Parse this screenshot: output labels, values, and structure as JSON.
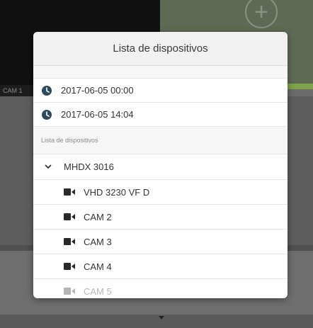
{
  "background": {
    "cam_label": "CAM 1",
    "add_button_glyph": "+"
  },
  "modal": {
    "title": "Lista de dispositivos",
    "recordings": [
      {
        "datetime": "2017-06-05 00:00",
        "icon": "clock-icon"
      },
      {
        "datetime": "2017-06-05 14:04",
        "icon": "clock-icon"
      }
    ],
    "device_section_label": "Lista de dispositivos",
    "device_group": {
      "name": "MHDX 3016",
      "icon": "chevron-down-icon"
    },
    "devices": [
      {
        "name": "VHD 3230 VF D",
        "icon": "video-camera-icon"
      },
      {
        "name": "CAM 2",
        "icon": "video-camera-icon"
      },
      {
        "name": "CAM 3",
        "icon": "video-camera-icon"
      },
      {
        "name": "CAM 4",
        "icon": "video-camera-icon"
      },
      {
        "name": "CAM 5",
        "icon": "video-camera-icon"
      }
    ]
  },
  "colors": {
    "accent_green": "#7ea24a",
    "icon_dark": "#2f4a5a",
    "overlay": "#6b6b6b"
  }
}
